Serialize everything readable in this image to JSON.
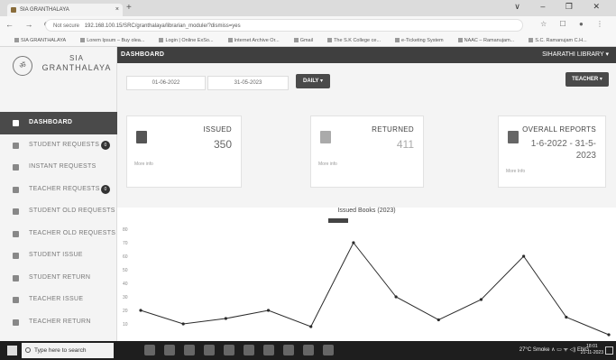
{
  "browser": {
    "tab_title": "SIA GRANTHALAYA",
    "tab_close": "×",
    "new_tab": "+",
    "window_controls": "∨ – ❐ ✕",
    "nav": "← → ⟳",
    "security_label": "Not secure",
    "url": "192.168.100.15/SRC/granthalaya/librarian_module/?dismiss=yes",
    "address_icons": "☆ ☐ ● ⋮",
    "bookmarks": [
      "SIA GRANTHALAYA",
      "Lorem Ipsum – Buy olea...",
      "Login | Online ExSo...",
      "Internet Archive Or...",
      "Gmail",
      "The S.K College ce...",
      "e-Ticketing System",
      "NAAC – Ramanujam...",
      "S.C. Ramanujam C.H..."
    ]
  },
  "brand": {
    "line1": "SIA",
    "line2": "GRANTHALAYA",
    "logo_glyph": "ॐ"
  },
  "sidebar": {
    "items": [
      {
        "label": "DASHBOARD",
        "icon": "dashboard-icon",
        "active": true
      },
      {
        "label": "STUDENT REQUESTS",
        "icon": "list-icon",
        "badge": "0"
      },
      {
        "label": "INSTANT REQUESTS",
        "icon": "hand-icon"
      },
      {
        "label": "TEACHER REQUESTS",
        "icon": "list-icon",
        "badge": "0"
      },
      {
        "label": "STUDENT OLD REQUESTS",
        "icon": "hand-icon"
      },
      {
        "label": "TEACHER OLD REQUESTS",
        "icon": "hand-icon"
      },
      {
        "label": "STUDENT ISSUE",
        "icon": "issue-icon"
      },
      {
        "label": "STUDENT RETURN",
        "icon": "return-icon"
      },
      {
        "label": "TEACHER ISSUE",
        "icon": "issue-icon"
      },
      {
        "label": "TEACHER RETURN",
        "icon": "return-icon"
      }
    ]
  },
  "topbar": {
    "title": "DASHBOARD",
    "user": "SIHARATHI LIBRARY ▾"
  },
  "filters": {
    "date_from": "01-06-2022",
    "date_to": "31-05-2023",
    "period": "DAILY ▾",
    "role": "TEACHER ▾"
  },
  "cards": {
    "issued": {
      "title": "ISSUED",
      "value": "350",
      "more": "More info"
    },
    "returned": {
      "title": "RETURNED",
      "value": "411",
      "more": "More info"
    },
    "overall": {
      "title": "OVERALL REPORTS",
      "value": "1-6-2022 - 31-5-2023",
      "more": "More Info"
    }
  },
  "taskbar": {
    "search_placeholder": "Type here to search",
    "tray": "27°C Smoke  ∧ ▭ ᯤ ◁) ENG",
    "time": "18:01",
    "date": "21-11-2023"
  },
  "colors": {
    "topbar": "#3f3f3f",
    "active_item": "#4a4a4a",
    "line": "#2b2b2b"
  },
  "chart_data": {
    "type": "line",
    "title": "Issued Books (2023)",
    "series": [
      {
        "values": [
          20,
          10,
          14,
          20,
          8,
          70,
          30,
          13,
          28,
          60,
          15,
          2
        ]
      }
    ],
    "ylim": [
      0,
      80
    ],
    "yticks": [
      80,
      70,
      60,
      50,
      40,
      30,
      20,
      10
    ],
    "grid": false,
    "legend": "top-center"
  }
}
